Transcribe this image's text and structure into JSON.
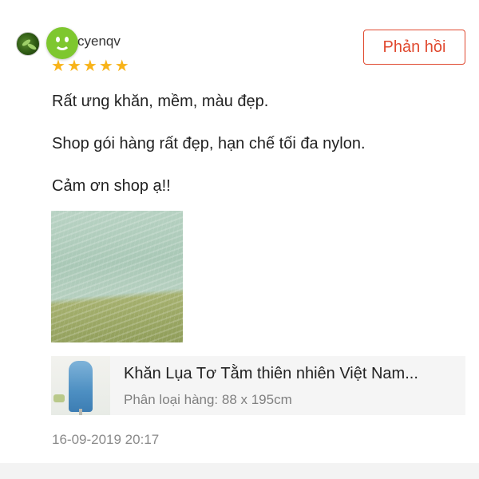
{
  "review": {
    "username": "cyenqv",
    "rating": 5,
    "stars": [
      "★",
      "★",
      "★",
      "★",
      "★"
    ],
    "reply_label": "Phản hồi",
    "lines": [
      "Rất ưng khăn, mềm, màu đẹp.",
      "Shop gói hàng rất đẹp, hạn chế tối đa nylon.",
      "Cảm ơn shop ạ!!"
    ],
    "timestamp": "16-09-2019 20:17"
  },
  "product": {
    "name": "Khăn Lụa Tơ Tằm thiên nhiên Việt Nam...",
    "variant": "Phân loại hàng: 88 x 195cm"
  },
  "colors": {
    "accent": "#e0492f",
    "star": "#f8b319",
    "smiley": "#7ec72f",
    "muted_text": "#808080",
    "card_bg": "#f5f5f5"
  },
  "icons": {
    "avatar": "user-avatar",
    "sticker": "smiley-face-icon",
    "star": "star-icon"
  }
}
